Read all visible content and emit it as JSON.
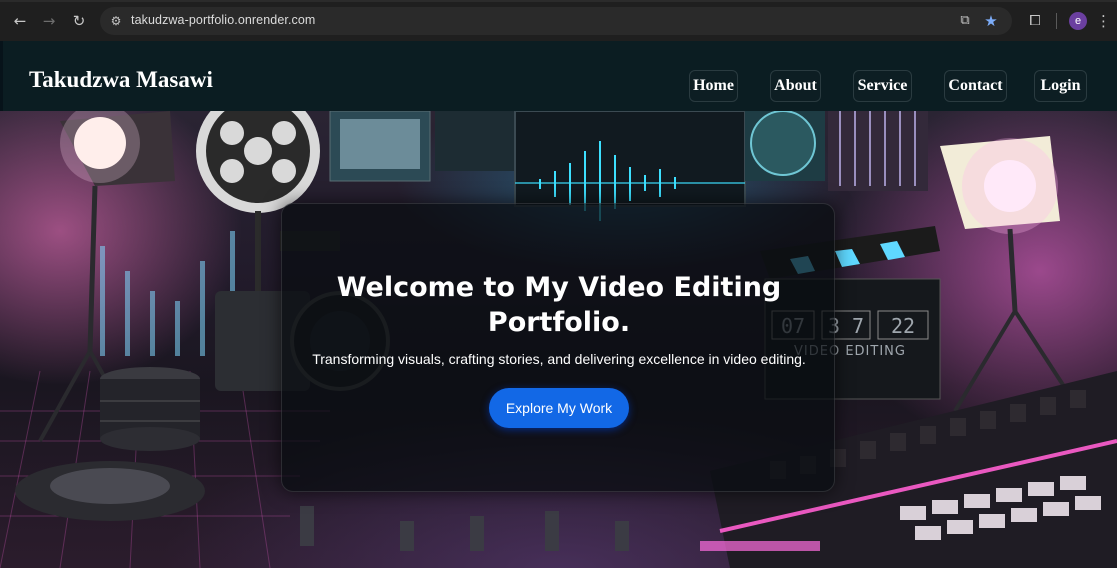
{
  "browser": {
    "url": "takudzwa-portfolio.onrender.com",
    "profile_initial": "e",
    "icons": {
      "back": "back-arrow-icon",
      "forward": "forward-arrow-icon",
      "reload": "reload-icon",
      "site_info": "site-info-icon",
      "install": "install-app-icon",
      "bookmark": "bookmark-star-icon",
      "extensions": "extensions-icon",
      "menu": "more-menu-icon"
    }
  },
  "header": {
    "brand": "Takudzwa Masawi",
    "nav": [
      {
        "label": "Home"
      },
      {
        "label": "About"
      },
      {
        "label": "Service"
      },
      {
        "label": "Contact"
      },
      {
        "label": "Login"
      }
    ]
  },
  "hero": {
    "title_line1": "Welcome to My Video Editing",
    "title_line2": "Portfolio.",
    "subtitle": "Transforming visuals, crafting stories, and delivering excellence in video editing.",
    "cta_label": "Explore My Work",
    "background": {
      "clapper_numbers": [
        "07",
        "3 7",
        "22"
      ],
      "clapper_text": "VIDEO EDITING"
    }
  },
  "colors": {
    "accent": "#1268e6",
    "header_bg": "#0b1d22",
    "neon_pink": "#ff5fd2",
    "neon_cyan": "#30d4ff"
  }
}
